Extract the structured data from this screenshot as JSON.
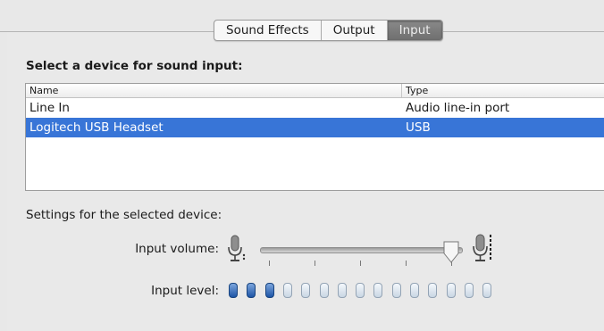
{
  "tabs": [
    {
      "label": "Sound Effects",
      "selected": false
    },
    {
      "label": "Output",
      "selected": false
    },
    {
      "label": "Input",
      "selected": true
    }
  ],
  "heading": "Select a device for sound input:",
  "table": {
    "columns": [
      "Name",
      "Type"
    ],
    "rows": [
      {
        "name": "Line In",
        "type": "Audio line-in port",
        "selected": false
      },
      {
        "name": "Logitech USB Headset",
        "type": "USB",
        "selected": true
      }
    ]
  },
  "settings_label": "Settings for the selected device:",
  "input_volume": {
    "label": "Input volume:",
    "value": 0.95
  },
  "input_level": {
    "label": "Input level:",
    "lit": 3,
    "total": 15
  },
  "colors": {
    "selection": "#3875d7",
    "led_on": "#1d55a6"
  },
  "icons": [
    "microphone-low-icon",
    "microphone-high-icon"
  ]
}
